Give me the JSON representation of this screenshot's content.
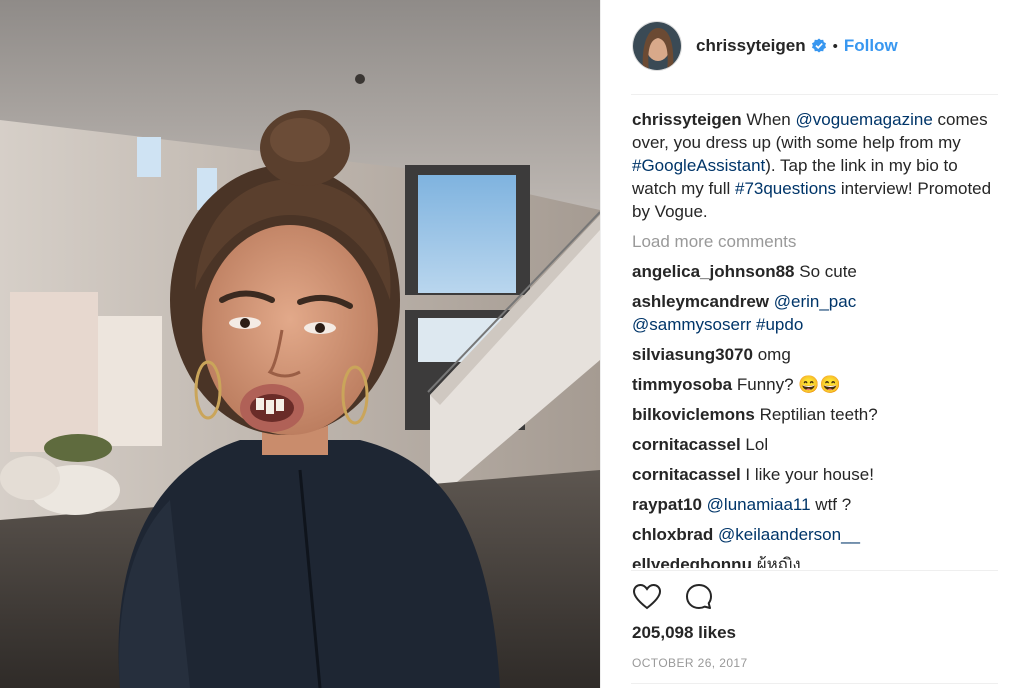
{
  "post": {
    "username": "chrissyteigen",
    "follow_label": "Follow",
    "separator": "•",
    "caption": {
      "username": "chrissyteigen",
      "parts": [
        "When ",
        "@voguemagazine",
        " comes over, you dress up (with some help from my ",
        "#GoogleAssistant",
        "). Tap the link in my bio to watch my full ",
        "#73questions",
        " interview! Promoted by Vogue."
      ]
    },
    "load_more_label": "Load more comments",
    "comments": [
      {
        "user": "angelica_johnson88",
        "text": "So cute"
      },
      {
        "user": "ashleymcandrew",
        "mention1": "@erin_pac",
        "mention2": "@sammysoserr",
        "tag": "#updo"
      },
      {
        "user": "silviasung3070",
        "text": "omg"
      },
      {
        "user": "timmyosoba",
        "text": "Funny? 😄😄"
      },
      {
        "user": "bilkoviclemons",
        "text": "Reptilian teeth?"
      },
      {
        "user": "cornitacassel",
        "text": "Lol"
      },
      {
        "user": "cornitacassel",
        "text": "I like your house!"
      },
      {
        "user": "raypat10",
        "mention": "@lunamiaa11",
        "text": " wtf ?"
      },
      {
        "user": "chloxbrad",
        "mention": "@keilaanderson__"
      },
      {
        "user": "ellyedeghonnu",
        "text": "ผู้หญิง"
      }
    ],
    "likes_label": "205,098 likes",
    "date_label": "OCTOBER 26, 2017"
  },
  "icons": {
    "verified": "verified-badge-icon",
    "like": "heart-icon",
    "comment": "comment-bubble-icon"
  },
  "colors": {
    "link": "#003569",
    "follow": "#3897f0",
    "verified": "#3897f0",
    "muted": "#999999",
    "text": "#262626"
  }
}
